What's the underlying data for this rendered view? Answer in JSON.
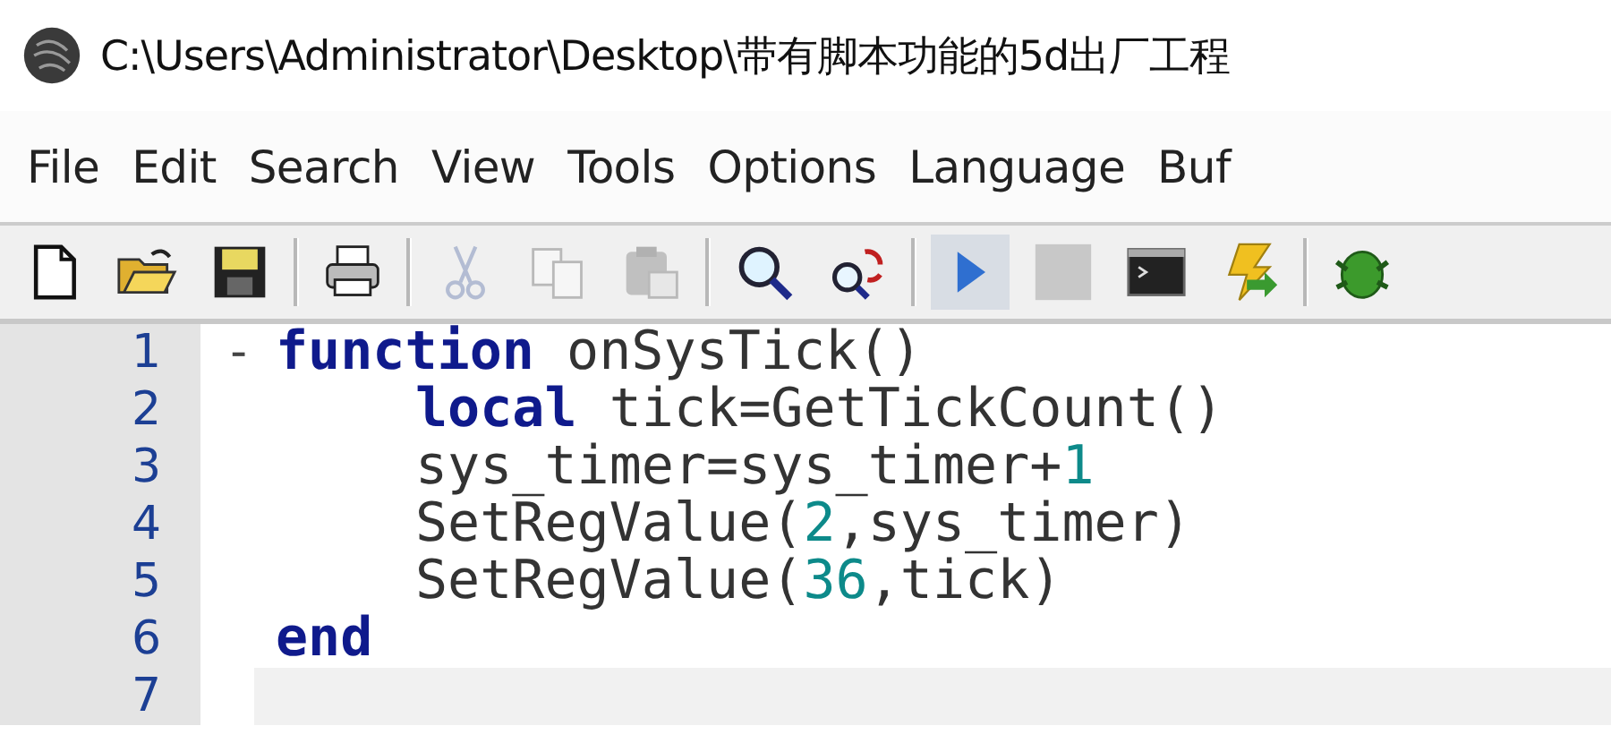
{
  "window": {
    "title": "C:\\Users\\Administrator\\Desktop\\带有脚本功能的5d出厂工程"
  },
  "menu": [
    {
      "label": "File"
    },
    {
      "label": "Edit"
    },
    {
      "label": "Search"
    },
    {
      "label": "View"
    },
    {
      "label": "Tools"
    },
    {
      "label": "Options"
    },
    {
      "label": "Language"
    },
    {
      "label": "Buf"
    }
  ],
  "toolbar": [
    {
      "kind": "new",
      "disabled": false
    },
    {
      "kind": "open",
      "disabled": false
    },
    {
      "kind": "save",
      "disabled": false
    },
    {
      "kind": "sep"
    },
    {
      "kind": "print",
      "disabled": false
    },
    {
      "kind": "sep"
    },
    {
      "kind": "cut",
      "disabled": true
    },
    {
      "kind": "copy",
      "disabled": true
    },
    {
      "kind": "paste",
      "disabled": true
    },
    {
      "kind": "sep"
    },
    {
      "kind": "find",
      "disabled": false
    },
    {
      "kind": "replace",
      "disabled": false
    },
    {
      "kind": "sep"
    },
    {
      "kind": "run",
      "disabled": false
    },
    {
      "kind": "stop",
      "disabled": true
    },
    {
      "kind": "terminal",
      "disabled": false
    },
    {
      "kind": "build",
      "disabled": false
    },
    {
      "kind": "sep"
    },
    {
      "kind": "bug",
      "disabled": false
    }
  ],
  "editor": {
    "lines": [
      {
        "number": "1",
        "fold_marker": "-",
        "current": false,
        "tokens": [
          {
            "kind": "keyword",
            "text": "function"
          },
          {
            "kind": "plain",
            "text": " onSysTick()"
          }
        ],
        "children": [
          {
            "number": "2",
            "current": false,
            "tokens": [
              {
                "kind": "keyword",
                "text": "local"
              },
              {
                "kind": "plain",
                "text": " tick=GetTickCount()"
              }
            ]
          },
          {
            "number": "3",
            "current": false,
            "tokens": [
              {
                "kind": "plain",
                "text": "sys_timer=sys_timer+"
              },
              {
                "kind": "number",
                "text": "1"
              }
            ]
          },
          {
            "number": "4",
            "current": false,
            "tokens": [
              {
                "kind": "plain",
                "text": "SetRegValue("
              },
              {
                "kind": "number",
                "text": "2"
              },
              {
                "kind": "plain",
                "text": ",sys_timer)"
              }
            ]
          },
          {
            "number": "5",
            "current": false,
            "tokens": [
              {
                "kind": "plain",
                "text": "SetRegValue("
              },
              {
                "kind": "number",
                "text": "36"
              },
              {
                "kind": "plain",
                "text": ",tick)"
              }
            ]
          }
        ]
      },
      {
        "number": "6",
        "current": false,
        "tokens": [
          {
            "kind": "keyword",
            "text": "end"
          }
        ]
      },
      {
        "number": "7",
        "current": true
      }
    ]
  }
}
